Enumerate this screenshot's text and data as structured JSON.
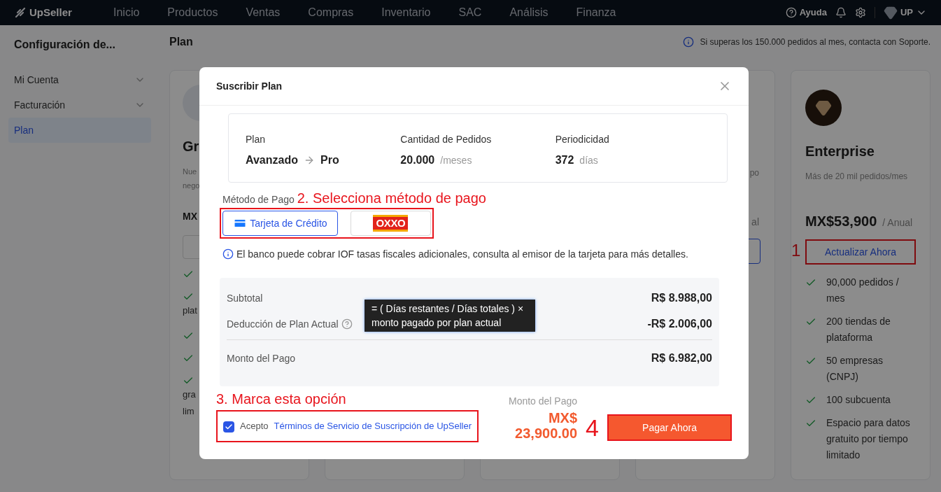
{
  "nav": {
    "logo": "UpSeller",
    "items": [
      {
        "label": "Inicio",
        "selected": false
      },
      {
        "label": "Productos",
        "selected": false
      },
      {
        "label": "Ventas",
        "selected": false
      },
      {
        "label": "Compras",
        "selected": false
      },
      {
        "label": "Inventario",
        "selected": false
      },
      {
        "label": "SAC",
        "selected": false
      },
      {
        "label": "Análisis",
        "selected": false
      },
      {
        "label": "Finanza",
        "selected": false
      }
    ],
    "help": "Ayuda",
    "user": "UP"
  },
  "sidebar": {
    "title": "Configuración de...",
    "items": [
      {
        "label": "Mi Cuenta",
        "expandable": true,
        "selected": false
      },
      {
        "label": "Facturación",
        "expandable": true,
        "selected": false
      },
      {
        "label": "Plan",
        "expandable": false,
        "selected": true
      }
    ]
  },
  "page": {
    "title": "Plan",
    "notice": "Si superas los 150.000 pedidos al mes, contacta con Soporte."
  },
  "cards": [
    {
      "kind": "left_partial",
      "title": "Gr",
      "description": [
        "Nue",
        "nego"
      ],
      "price": "MX",
      "features": [
        {
          "check": true
        },
        {
          "check": true,
          "more": [
            "plat"
          ]
        },
        {
          "check": true
        },
        {
          "check": true
        },
        {
          "check": true,
          "more": [
            "gra",
            "lim"
          ]
        }
      ]
    },
    {
      "kind": "hidden"
    },
    {
      "kind": "hidden"
    },
    {
      "kind": "right_partial",
      "description": "po",
      "period": "al"
    },
    {
      "kind": "full",
      "title": "Enterprise",
      "description": "Más de 20 mil pedidos/mes",
      "price": "MX$53,900",
      "period": "/ Anual",
      "button": "Actualizar Ahora",
      "annotation": "1",
      "features": [
        "90,000 pedidos / mes",
        "200 tiendas de plataforma",
        "50 empresas (CNPJ)",
        "100 subcuenta",
        "Espacio para datos gratuito por tiempo limitado"
      ]
    }
  ],
  "modal": {
    "title": "Suscribir Plan",
    "summary": {
      "plan_label": "Plan",
      "from": "Avanzado",
      "to": "Pro",
      "quantity_label": "Cantidad de Pedidos",
      "quantity": "20.000",
      "quantity_unit": "/meses",
      "period_label": "Periodicidad",
      "period": "372",
      "period_unit": "días"
    },
    "payment_label": "Método de Pago",
    "payment_annotation": "2. Selecciona método de pago",
    "payment_methods": [
      {
        "kind": "card",
        "label": "Tarjeta de Crédito",
        "selected": true
      },
      {
        "kind": "oxxo",
        "label": "OXXO",
        "selected": false
      }
    ],
    "notice": "El banco puede cobrar IOF tasas fiscales adicionales, consulta al emisor de la tarjeta para más detalles.",
    "breakdown": [
      {
        "label": "Subtotal",
        "value": "R$ 8.988,00",
        "help": false,
        "divider_after": false
      },
      {
        "label": "Deducción de Plan Actual",
        "value": "-R$ 2.006,00",
        "help": true,
        "divider_after": true
      },
      {
        "label": "Monto del Pago",
        "value": "R$ 6.982,00",
        "help": false,
        "divider_after": false
      }
    ],
    "tooltip": "= ( Días restantes / Días totales ) × monto pagado por plan actual",
    "terms_annotation": "3. Marca esta opción",
    "terms_checked": true,
    "terms_label": "Acepto",
    "terms_link": "Términos de Servicio de Suscripción de UpSeller",
    "total_label": "Monto del Pago",
    "total": "MX$ 23,900.00",
    "pay_annotation": "4",
    "pay_button": "Pagar Ahora"
  }
}
